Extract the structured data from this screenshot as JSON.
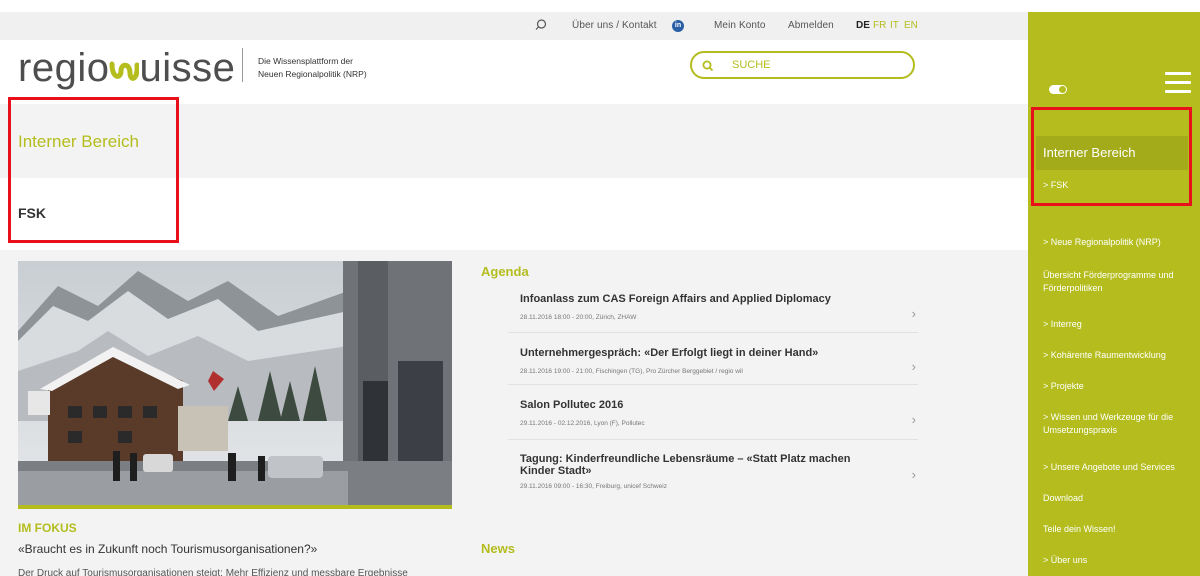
{
  "topbar": {
    "about": "Über uns / Kontakt",
    "account": "Mein Konto",
    "logout": "Abmelden",
    "languages": [
      "DE",
      "FR",
      "IT",
      "EN"
    ],
    "active_language": "DE",
    "linkedin": "in"
  },
  "header": {
    "logo_text_1": "regio",
    "logo_text_2": "uisse",
    "tagline_1": "Die Wissensplattform der",
    "tagline_2": "Neuen Regionalpolitik (NRP)",
    "search_placeholder": "SUCHE"
  },
  "internal": {
    "title": "Interner Bereich",
    "sub": "FSK"
  },
  "fokus": {
    "kicker": "IM FOKUS",
    "title": "«Braucht es in Zukunft noch Tourismusorganisationen?»",
    "text": "Der Druck auf Tourismusorganisationen steigt: Mehr Effizienz und messbare Ergebnisse"
  },
  "agenda": {
    "heading": "Agenda",
    "items": [
      {
        "title": "Infoanlass zum CAS Foreign Affairs and Applied Diplomacy",
        "meta": "28.11.2016 18:00 - 20:00, Zürich, ZHAW"
      },
      {
        "title": "Unternehmergespräch: «Der Erfolgt liegt in deiner Hand»",
        "meta": "28.11.2016 19:00 - 21:00, Fischingen (TG), Pro Zürcher Berggebiet / regio wil"
      },
      {
        "title": "Salon Pollutec 2016",
        "meta": "29.11.2016 - 02.12.2016, Lyon (F), Pollutec"
      },
      {
        "title": "Tagung: Kinderfreundliche Lebensräume – «Statt Platz machen Kinder Stadt»",
        "meta": "29.11.2016 09:00 - 16:30, Freiburg, unicef Schweiz"
      }
    ]
  },
  "news": {
    "heading": "News"
  },
  "rightnav": {
    "active_title": "Interner Bereich",
    "active_sub": "> FSK",
    "links": [
      "> Neue Regionalpolitik (NRP)",
      "Übersicht Förderprogramme und Förderpolitiken",
      "> Interreg",
      "> Kohärente Raumentwicklung",
      "> Projekte",
      "> Wissen und Werkzeuge für die Umsetzungspraxis",
      "> Unsere Angebote und Services",
      "Download",
      "Teile dein Wissen!",
      "> Über uns"
    ]
  },
  "colors": {
    "accent": "#b4bd1d",
    "highlight": "#e8101a",
    "linkedin": "#2a5fa6"
  }
}
